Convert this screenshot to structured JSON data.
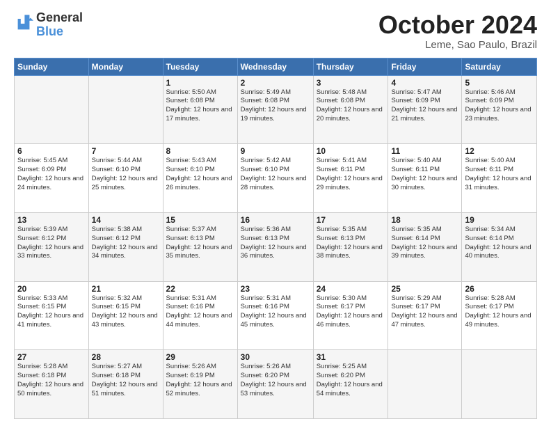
{
  "header": {
    "logo_line1": "General",
    "logo_line2": "Blue",
    "month": "October 2024",
    "location": "Leme, Sao Paulo, Brazil"
  },
  "weekdays": [
    "Sunday",
    "Monday",
    "Tuesday",
    "Wednesday",
    "Thursday",
    "Friday",
    "Saturday"
  ],
  "weeks": [
    [
      {
        "day": "",
        "info": ""
      },
      {
        "day": "",
        "info": ""
      },
      {
        "day": "1",
        "info": "Sunrise: 5:50 AM\nSunset: 6:08 PM\nDaylight: 12 hours and 17 minutes."
      },
      {
        "day": "2",
        "info": "Sunrise: 5:49 AM\nSunset: 6:08 PM\nDaylight: 12 hours and 19 minutes."
      },
      {
        "day": "3",
        "info": "Sunrise: 5:48 AM\nSunset: 6:08 PM\nDaylight: 12 hours and 20 minutes."
      },
      {
        "day": "4",
        "info": "Sunrise: 5:47 AM\nSunset: 6:09 PM\nDaylight: 12 hours and 21 minutes."
      },
      {
        "day": "5",
        "info": "Sunrise: 5:46 AM\nSunset: 6:09 PM\nDaylight: 12 hours and 23 minutes."
      }
    ],
    [
      {
        "day": "6",
        "info": "Sunrise: 5:45 AM\nSunset: 6:09 PM\nDaylight: 12 hours and 24 minutes."
      },
      {
        "day": "7",
        "info": "Sunrise: 5:44 AM\nSunset: 6:10 PM\nDaylight: 12 hours and 25 minutes."
      },
      {
        "day": "8",
        "info": "Sunrise: 5:43 AM\nSunset: 6:10 PM\nDaylight: 12 hours and 26 minutes."
      },
      {
        "day": "9",
        "info": "Sunrise: 5:42 AM\nSunset: 6:10 PM\nDaylight: 12 hours and 28 minutes."
      },
      {
        "day": "10",
        "info": "Sunrise: 5:41 AM\nSunset: 6:11 PM\nDaylight: 12 hours and 29 minutes."
      },
      {
        "day": "11",
        "info": "Sunrise: 5:40 AM\nSunset: 6:11 PM\nDaylight: 12 hours and 30 minutes."
      },
      {
        "day": "12",
        "info": "Sunrise: 5:40 AM\nSunset: 6:11 PM\nDaylight: 12 hours and 31 minutes."
      }
    ],
    [
      {
        "day": "13",
        "info": "Sunrise: 5:39 AM\nSunset: 6:12 PM\nDaylight: 12 hours and 33 minutes."
      },
      {
        "day": "14",
        "info": "Sunrise: 5:38 AM\nSunset: 6:12 PM\nDaylight: 12 hours and 34 minutes."
      },
      {
        "day": "15",
        "info": "Sunrise: 5:37 AM\nSunset: 6:13 PM\nDaylight: 12 hours and 35 minutes."
      },
      {
        "day": "16",
        "info": "Sunrise: 5:36 AM\nSunset: 6:13 PM\nDaylight: 12 hours and 36 minutes."
      },
      {
        "day": "17",
        "info": "Sunrise: 5:35 AM\nSunset: 6:13 PM\nDaylight: 12 hours and 38 minutes."
      },
      {
        "day": "18",
        "info": "Sunrise: 5:35 AM\nSunset: 6:14 PM\nDaylight: 12 hours and 39 minutes."
      },
      {
        "day": "19",
        "info": "Sunrise: 5:34 AM\nSunset: 6:14 PM\nDaylight: 12 hours and 40 minutes."
      }
    ],
    [
      {
        "day": "20",
        "info": "Sunrise: 5:33 AM\nSunset: 6:15 PM\nDaylight: 12 hours and 41 minutes."
      },
      {
        "day": "21",
        "info": "Sunrise: 5:32 AM\nSunset: 6:15 PM\nDaylight: 12 hours and 43 minutes."
      },
      {
        "day": "22",
        "info": "Sunrise: 5:31 AM\nSunset: 6:16 PM\nDaylight: 12 hours and 44 minutes."
      },
      {
        "day": "23",
        "info": "Sunrise: 5:31 AM\nSunset: 6:16 PM\nDaylight: 12 hours and 45 minutes."
      },
      {
        "day": "24",
        "info": "Sunrise: 5:30 AM\nSunset: 6:17 PM\nDaylight: 12 hours and 46 minutes."
      },
      {
        "day": "25",
        "info": "Sunrise: 5:29 AM\nSunset: 6:17 PM\nDaylight: 12 hours and 47 minutes."
      },
      {
        "day": "26",
        "info": "Sunrise: 5:28 AM\nSunset: 6:17 PM\nDaylight: 12 hours and 49 minutes."
      }
    ],
    [
      {
        "day": "27",
        "info": "Sunrise: 5:28 AM\nSunset: 6:18 PM\nDaylight: 12 hours and 50 minutes."
      },
      {
        "day": "28",
        "info": "Sunrise: 5:27 AM\nSunset: 6:18 PM\nDaylight: 12 hours and 51 minutes."
      },
      {
        "day": "29",
        "info": "Sunrise: 5:26 AM\nSunset: 6:19 PM\nDaylight: 12 hours and 52 minutes."
      },
      {
        "day": "30",
        "info": "Sunrise: 5:26 AM\nSunset: 6:20 PM\nDaylight: 12 hours and 53 minutes."
      },
      {
        "day": "31",
        "info": "Sunrise: 5:25 AM\nSunset: 6:20 PM\nDaylight: 12 hours and 54 minutes."
      },
      {
        "day": "",
        "info": ""
      },
      {
        "day": "",
        "info": ""
      }
    ]
  ]
}
